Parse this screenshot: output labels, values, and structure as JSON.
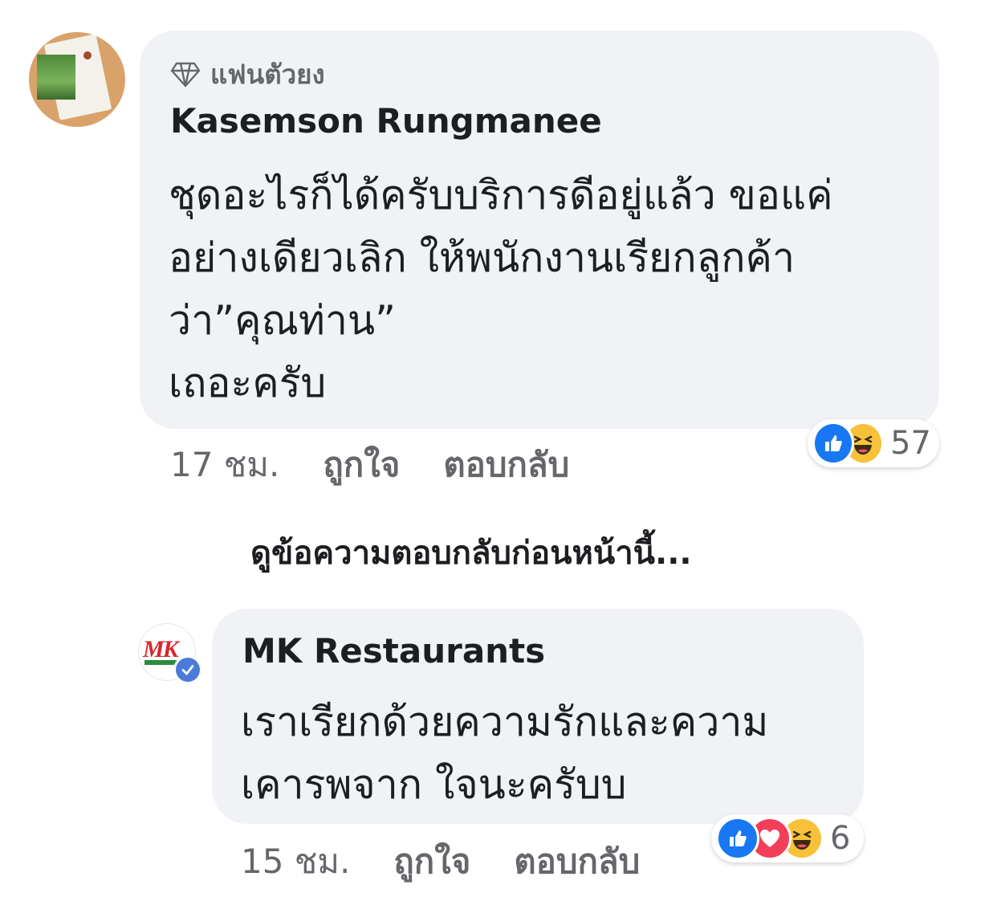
{
  "comment1": {
    "badge": "แฟนตัวยง",
    "author": "Kasemson Rungmanee",
    "text_lines": [
      "ชุดอะไรก็ได้ครับบริการดีอยู่แล้ว ขอแค่",
      "อย่างเดียวเลิก ให้พนักงานเรียกลูกค้า",
      "ว่า”คุณท่าน”",
      "เถอะครับ"
    ],
    "time": "17 ชม.",
    "like_label": "ถูกใจ",
    "reply_label": "ตอบกลับ",
    "reactions": [
      "like-icon",
      "haha-icon"
    ],
    "reaction_count": "57"
  },
  "view_previous": "ดูข้อความตอบกลับก่อนหน้านี้...",
  "comment2": {
    "author": "MK Restaurants",
    "verified": true,
    "avatar_text": "MK",
    "text_lines": [
      "เราเรียกด้วยความรักและความ",
      "เคารพจาก ใจนะครับบ"
    ],
    "time": "15 ชม.",
    "like_label": "ถูกใจ",
    "reply_label": "ตอบกลับ",
    "reactions": [
      "like-icon",
      "love-icon",
      "haha-icon"
    ],
    "reaction_count": "6"
  },
  "colors": {
    "bubble": "#f0f2f5",
    "like": "#1877f2",
    "love": "#f33e58",
    "haha": "#f7c23a",
    "verified": "#4a7bd8"
  }
}
